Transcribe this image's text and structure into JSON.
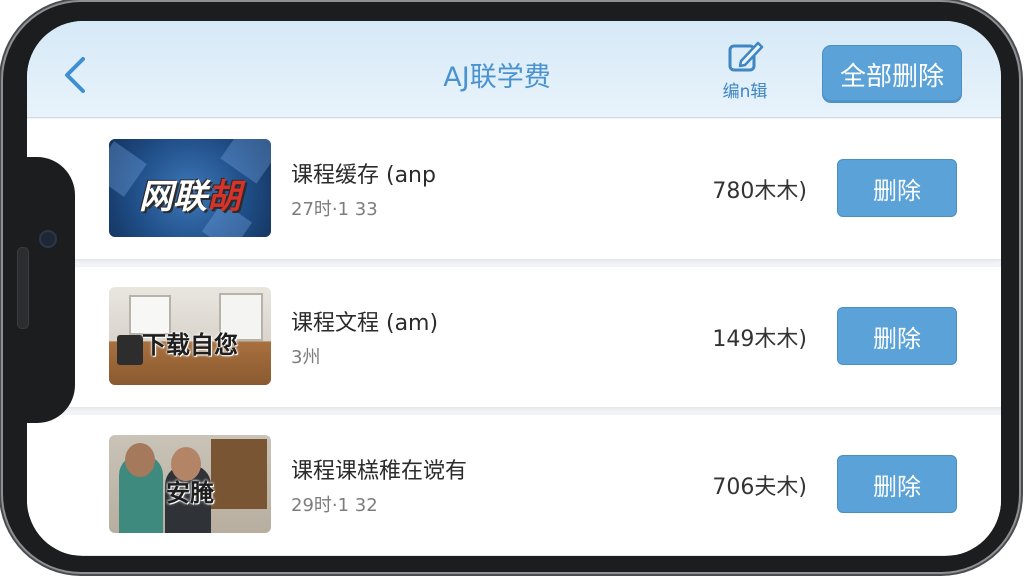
{
  "header": {
    "title": "AJ联学费",
    "edit_label": "编n辑",
    "delete_all_label": "全部删除"
  },
  "colors": {
    "accent": "#5aa2d8",
    "header_bg": "#d6e9f7",
    "title_text": "#4a93cf"
  },
  "icons": {
    "back": "chevron-left-icon",
    "edit": "pencil-square-icon"
  },
  "items": [
    {
      "thumb_text_a": "网联",
      "thumb_text_b": "胡",
      "title": "课程缓存 (anp",
      "subtitle": "27时·1 33",
      "size": "780木木)",
      "delete_label": "删除"
    },
    {
      "thumb_text": "下载自您",
      "title": "课程文程 (am)",
      "subtitle": "3州",
      "size": "149木木)",
      "delete_label": "删除"
    },
    {
      "thumb_text": "安腌",
      "title": "课程课榚稚在谠有",
      "subtitle": "29时·1 32",
      "size": "706夫木)",
      "delete_label": "删除"
    }
  ]
}
